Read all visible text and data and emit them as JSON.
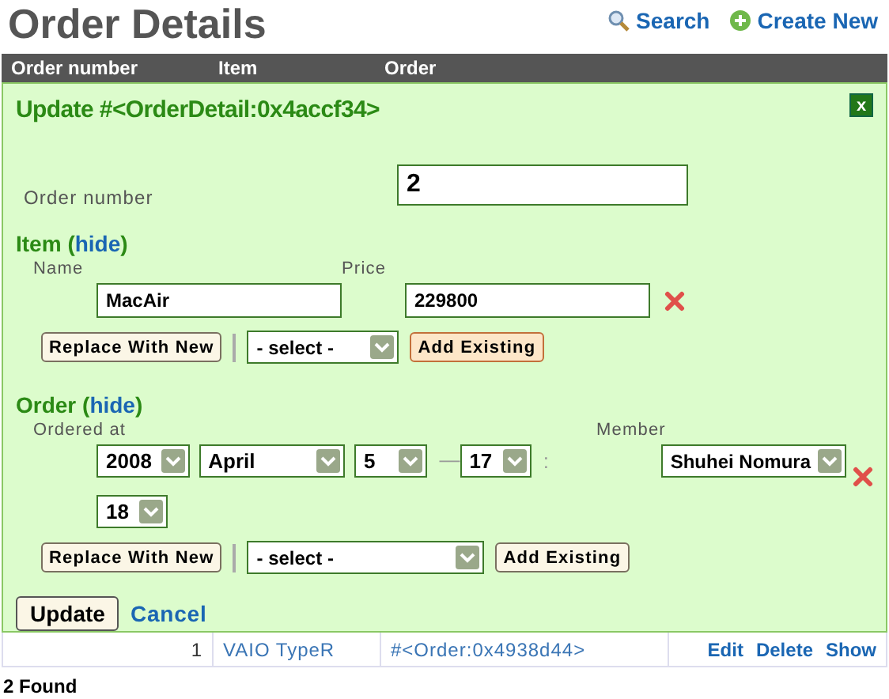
{
  "page": {
    "title": "Order Details",
    "links": [
      {
        "label": "Search",
        "kind": "search"
      },
      {
        "label": "Create New",
        "kind": "add"
      }
    ]
  },
  "table": {
    "columns": [
      "Order number",
      "Item",
      "Order"
    ],
    "form": {
      "title": "Update #<OrderDetail:0x4accf34>",
      "close": "x",
      "order_number": {
        "label": "Order number",
        "value": "2"
      },
      "item": {
        "heading": "Item",
        "paren_open": "(",
        "toggle": "hide",
        "paren_close": ")",
        "labels": [
          "Name",
          "Price"
        ],
        "values": [
          "MacAir",
          "229800"
        ],
        "replace": "Replace With New",
        "select": "- select -",
        "add": "Add Existing"
      },
      "order": {
        "heading": "Order",
        "paren_open": "(",
        "toggle": "hide",
        "paren_close": ")",
        "label": "Ordered at",
        "member_label": "Member",
        "year": "2008",
        "month": "April",
        "day": "5",
        "dash": "—",
        "hour": "17",
        "colon": ":",
        "minute": "18",
        "member": "Shuhei Nomura",
        "replace": "Replace With New",
        "select": "- select -",
        "add": "Add Existing"
      },
      "submit": "Update",
      "cancel": "Cancel"
    },
    "rows": [
      {
        "cells": [
          "1",
          "VAIO TypeR",
          "#<Order:0x4938d44>"
        ],
        "actions": [
          "Edit",
          "Delete",
          "Show"
        ]
      }
    ]
  },
  "footer": "2 Found"
}
